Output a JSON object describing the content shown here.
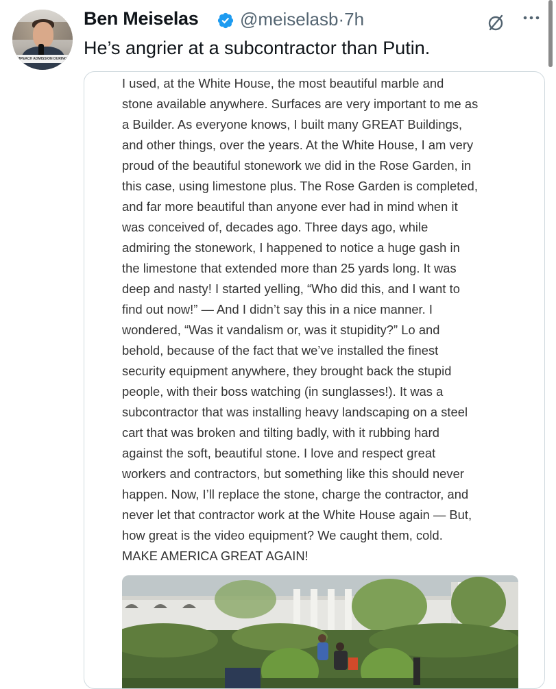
{
  "tweet": {
    "author_name": "Ben Meiselas",
    "verified": true,
    "handle": "@meiselasb",
    "separator": "·",
    "time": "7h",
    "text": "He’s angrier at a subcontractor than Putin.",
    "avatar_banner": "IMPEACH ADMISSION DURING TRIAL"
  },
  "toolbar": {
    "grok_icon": "slashed-circle-icon",
    "more_icon": "more-dots-icon"
  },
  "embedded_post": {
    "lines": [
      "I used, at the White House, the most beautiful marble and",
      "stone available anywhere. Surfaces are very important to me as",
      "a Builder. As everyone knows, I built many GREAT Buildings,",
      "and other things, over the years. At the White House, I am very",
      "proud of the beautiful stonework we did in the Rose Garden, in",
      "this case, using limestone plus. The Rose Garden is completed,",
      "and far more beautiful than anyone ever had in mind when it",
      "was conceived of, decades ago. Three days ago, while",
      "admiring the stonework, I happened to notice a huge gash in",
      "the limestone that extended more than 25 yards long. It was",
      "deep and nasty! I started yelling, “Who did this, and I want to",
      "find out now!” — And I didn’t say this in a nice manner. I",
      "wondered, “Was it vandalism or, was it stupidity?” Lo and",
      "behold, because of the fact that we’ve installed the finest",
      "security equipment anywhere, they brought back the stupid",
      "people, with their boss watching (in sunglasses!). It was a",
      "subcontractor that was installing heavy landscaping on a steel",
      "cart that was broken and tilting badly, with it rubbing hard",
      "against the soft, beautiful stone. I love and respect great",
      "workers and contractors, but something like this should never",
      "happen. Now, I’ll replace the stone, charge the contractor, and",
      "never let that contractor work at the White House again — But,",
      "how great is the video equipment? We caught them, cold.",
      "MAKE AMERICA GREAT AGAIN!"
    ]
  },
  "colors": {
    "verified_blue": "#1d9bf0",
    "handle_gray": "#536471",
    "card_border": "#cfd9de"
  }
}
